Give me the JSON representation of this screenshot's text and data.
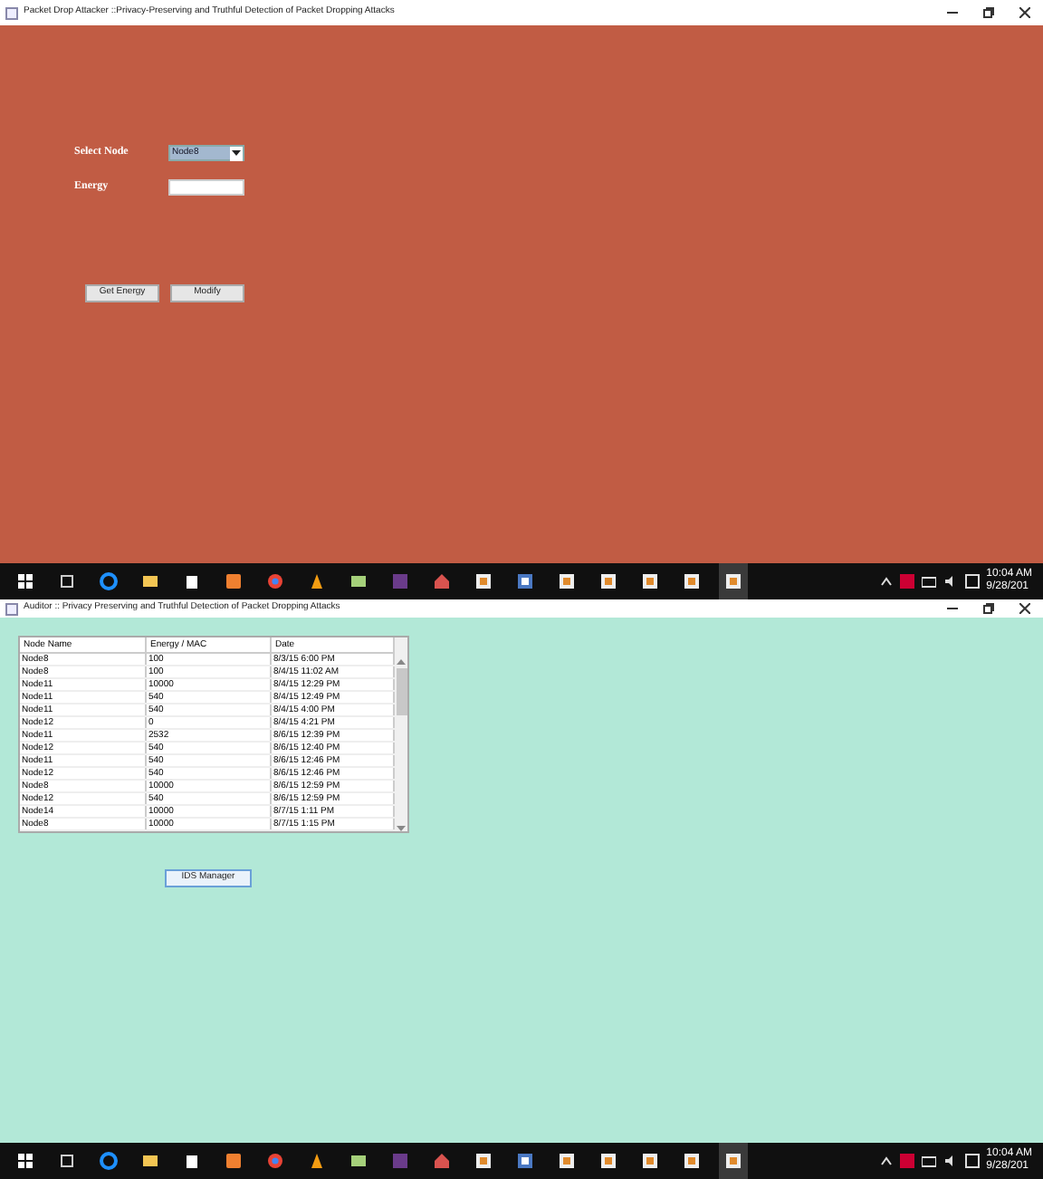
{
  "windows": [
    {
      "title": "Packet Drop Attacker ::Privacy-Preserving and Truthful Detection of Packet Dropping Attacks",
      "kind": "attacker",
      "form": {
        "select_label": "Select Node",
        "select_value": "Node8",
        "energy_label": "Energy",
        "buttons": [
          "Get Energy",
          "Modify"
        ]
      },
      "taskbar": {
        "items": [
          {
            "selected": false
          },
          {
            "selected": false
          },
          {
            "selected": false
          },
          {
            "selected": false
          },
          {
            "selected": false
          },
          {
            "selected": false
          },
          {
            "selected": false
          },
          {
            "selected": false
          },
          {
            "selected": false
          },
          {
            "selected": false
          },
          {
            "selected": false
          },
          {
            "selected": false
          },
          {
            "selected": false
          },
          {
            "selected": false
          },
          {
            "selected": false
          },
          {
            "selected": false
          },
          {
            "selected": false
          },
          {
            "selected": true
          }
        ],
        "time": "10:04 AM",
        "date": "9/28/201"
      }
    },
    {
      "title": "Auditor :: Privacy Preserving and Truthful Detection of Packet Dropping Attacks",
      "kind": "auditor",
      "table": {
        "columns": [
          "Node Name",
          "Energy / MAC",
          "Date"
        ],
        "rows": [
          [
            "Node8",
            "100",
            "8/3/15 6:00 PM"
          ],
          [
            "Node8",
            "100",
            "8/4/15 11:02 AM"
          ],
          [
            "Node11",
            "10000",
            "8/4/15 12:29 PM"
          ],
          [
            "Node11",
            "540",
            "8/4/15 12:49 PM"
          ],
          [
            "Node11",
            "540",
            "8/4/15 4:00 PM"
          ],
          [
            "Node12",
            "0",
            "8/4/15 4:21 PM"
          ],
          [
            "Node11",
            "2532",
            "8/6/15 12:39 PM"
          ],
          [
            "Node12",
            "540",
            "8/6/15 12:40 PM"
          ],
          [
            "Node11",
            "540",
            "8/6/15 12:46 PM"
          ],
          [
            "Node12",
            "540",
            "8/6/15 12:46 PM"
          ],
          [
            "Node8",
            "10000",
            "8/6/15 12:59 PM"
          ],
          [
            "Node12",
            "540",
            "8/6/15 12:59 PM"
          ],
          [
            "Node14",
            "10000",
            "8/7/15 1:11 PM"
          ],
          [
            "Node8",
            "10000",
            "8/7/15 1:15 PM"
          ]
        ]
      },
      "buttons": [
        "IDS Manager"
      ],
      "taskbar": {
        "items": [
          {
            "selected": false
          },
          {
            "selected": false
          },
          {
            "selected": false
          },
          {
            "selected": false
          },
          {
            "selected": false
          },
          {
            "selected": false
          },
          {
            "selected": false
          },
          {
            "selected": false
          },
          {
            "selected": false
          },
          {
            "selected": false
          },
          {
            "selected": false
          },
          {
            "selected": false
          },
          {
            "selected": false
          },
          {
            "selected": false
          },
          {
            "selected": false
          },
          {
            "selected": false
          },
          {
            "selected": false
          },
          {
            "selected": true
          }
        ],
        "time": "10:04 AM",
        "date": "9/28/201"
      }
    }
  ]
}
